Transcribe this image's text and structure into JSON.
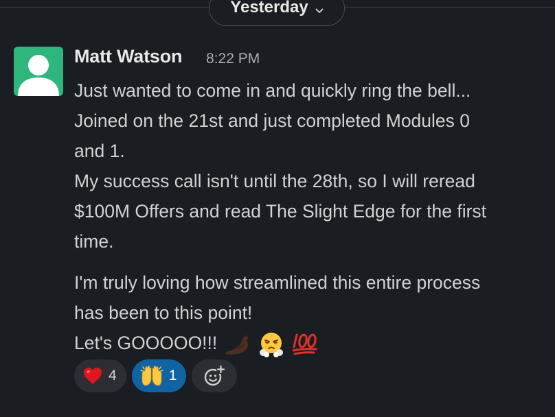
{
  "divider": {
    "label": "Yesterday"
  },
  "message": {
    "sender": "Matt Watson",
    "timestamp": "8:22 PM",
    "lines_para1": [
      "Just wanted to come in and quickly ring the bell...",
      "Joined on the 21st and just completed Modules 0",
      "and 1.",
      "My success call isn't until the 28th, so I will reread",
      "$100M Offers and read The Slight Edge for the first",
      "time."
    ],
    "lines_para2": [
      "I'm truly loving how streamlined this entire process",
      "has been to this point!",
      "Let's GOOOOO!!!"
    ],
    "trailing_emojis": [
      "flexed-biceps",
      "face-with-steam",
      "hundred-points"
    ]
  },
  "reactions": [
    {
      "emoji": "red-heart",
      "count": "4",
      "active": false
    },
    {
      "emoji": "raising-hands",
      "count": "1",
      "active": true
    }
  ],
  "colors": {
    "background": "#1a1d21",
    "avatar": "#2eb67d",
    "active_reaction": "#1164a3"
  }
}
